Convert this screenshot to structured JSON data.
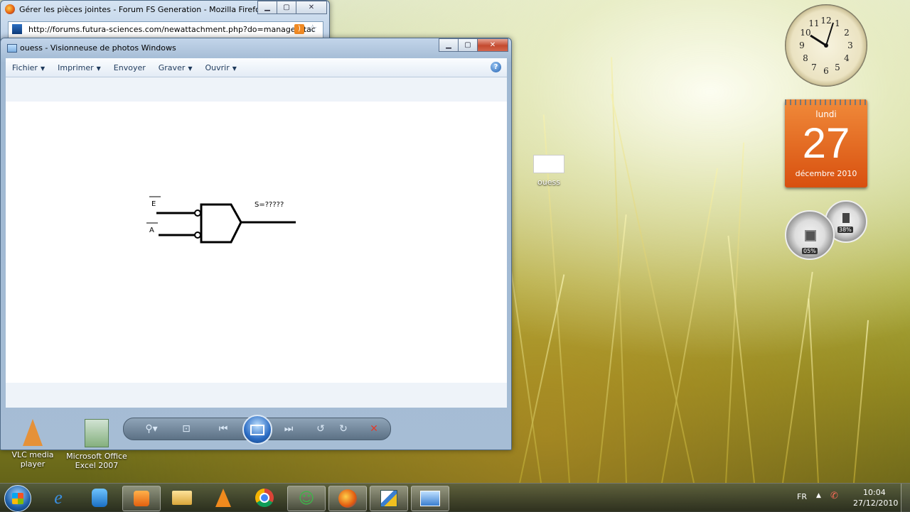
{
  "firefox": {
    "title": "Gérer les pièces jointes - Forum FS Generation - Mozilla Firefox",
    "url": "http://forums.futura-sciences.com/newattachment.php?do=manageattac"
  },
  "photo_viewer": {
    "title": "ouess - Visionneuse de photos Windows",
    "menu": [
      "Fichier",
      "Imprimer",
      "Envoyer",
      "Graver",
      "Ouvrir"
    ],
    "diagram": {
      "input_top": "E",
      "input_bottom": "A",
      "output": "S=?????"
    }
  },
  "desktop": {
    "icons": [
      {
        "label": "VLC media player"
      },
      {
        "label": "Microsoft Office Excel 2007"
      },
      {
        "label": "ouess"
      }
    ]
  },
  "gadgets": {
    "clock_numbers": [
      "12",
      "1",
      "2",
      "3",
      "4",
      "5",
      "6",
      "7",
      "8",
      "9",
      "10",
      "11"
    ],
    "calendar": {
      "weekday": "lundi",
      "day": "27",
      "month_year": "décembre 2010"
    },
    "meter": {
      "cpu": "05%",
      "memory": "38%"
    }
  },
  "taskbar": {
    "language": "FR",
    "time": "10:04",
    "date": "27/12/2010"
  }
}
